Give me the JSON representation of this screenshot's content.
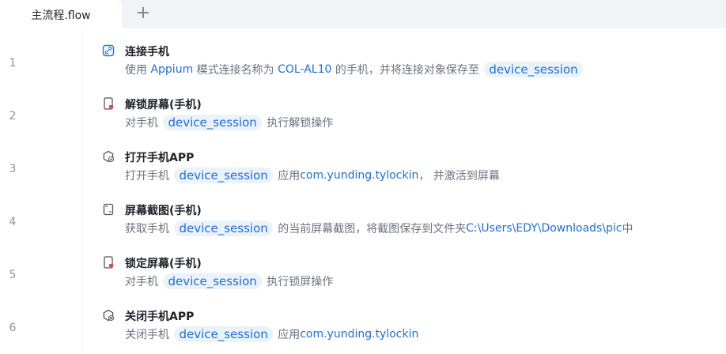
{
  "tabs": {
    "active_label": "主流程.flow",
    "add_label": "+"
  },
  "steps": [
    {
      "line": "1",
      "icon": "link-icon",
      "title": "连接手机",
      "desc": [
        {
          "t": "使用 ",
          "s": "plain"
        },
        {
          "t": "Appium",
          "s": "blue"
        },
        {
          "t": " 模式连接名称为 ",
          "s": "plain"
        },
        {
          "t": "COL-AL10",
          "s": "blue"
        },
        {
          "t": " 的手机，并将连接对象保存至 ",
          "s": "plain"
        },
        {
          "t": "device_session",
          "s": "var"
        }
      ]
    },
    {
      "line": "2",
      "icon": "phone-unlock-icon",
      "title": "解锁屏幕(手机)",
      "desc": [
        {
          "t": "对手机 ",
          "s": "plain"
        },
        {
          "t": "device_session",
          "s": "var"
        },
        {
          "t": " 执行解锁操作",
          "s": "plain"
        }
      ]
    },
    {
      "line": "3",
      "icon": "app-open-icon",
      "title": "打开手机APP",
      "desc": [
        {
          "t": "打开手机 ",
          "s": "plain"
        },
        {
          "t": "device_session",
          "s": "var"
        },
        {
          "t": " 应用",
          "s": "plain"
        },
        {
          "t": "com.yunding.tylockin",
          "s": "blue"
        },
        {
          "t": "， 并激活到屏幕",
          "s": "plain"
        }
      ]
    },
    {
      "line": "4",
      "icon": "screenshot-icon",
      "title": "屏幕截图(手机)",
      "desc": [
        {
          "t": "获取手机 ",
          "s": "plain"
        },
        {
          "t": "device_session",
          "s": "var"
        },
        {
          "t": " 的当前屏幕截图，将截图保存到文件夹",
          "s": "plain"
        },
        {
          "t": "C:\\Users\\EDY\\Downloads\\pic",
          "s": "blue"
        },
        {
          "t": "中",
          "s": "plain"
        }
      ]
    },
    {
      "line": "5",
      "icon": "phone-lock-icon",
      "title": "锁定屏幕(手机)",
      "desc": [
        {
          "t": "对手机 ",
          "s": "plain"
        },
        {
          "t": "device_session",
          "s": "var"
        },
        {
          "t": " 执行锁屏操作",
          "s": "plain"
        }
      ]
    },
    {
      "line": "6",
      "icon": "app-close-icon",
      "title": "关闭手机APP",
      "desc": [
        {
          "t": "关闭手机 ",
          "s": "plain"
        },
        {
          "t": "device_session",
          "s": "var"
        },
        {
          "t": " 应用",
          "s": "plain"
        },
        {
          "t": "com.yunding.tylockin",
          "s": "blue"
        }
      ]
    }
  ]
}
